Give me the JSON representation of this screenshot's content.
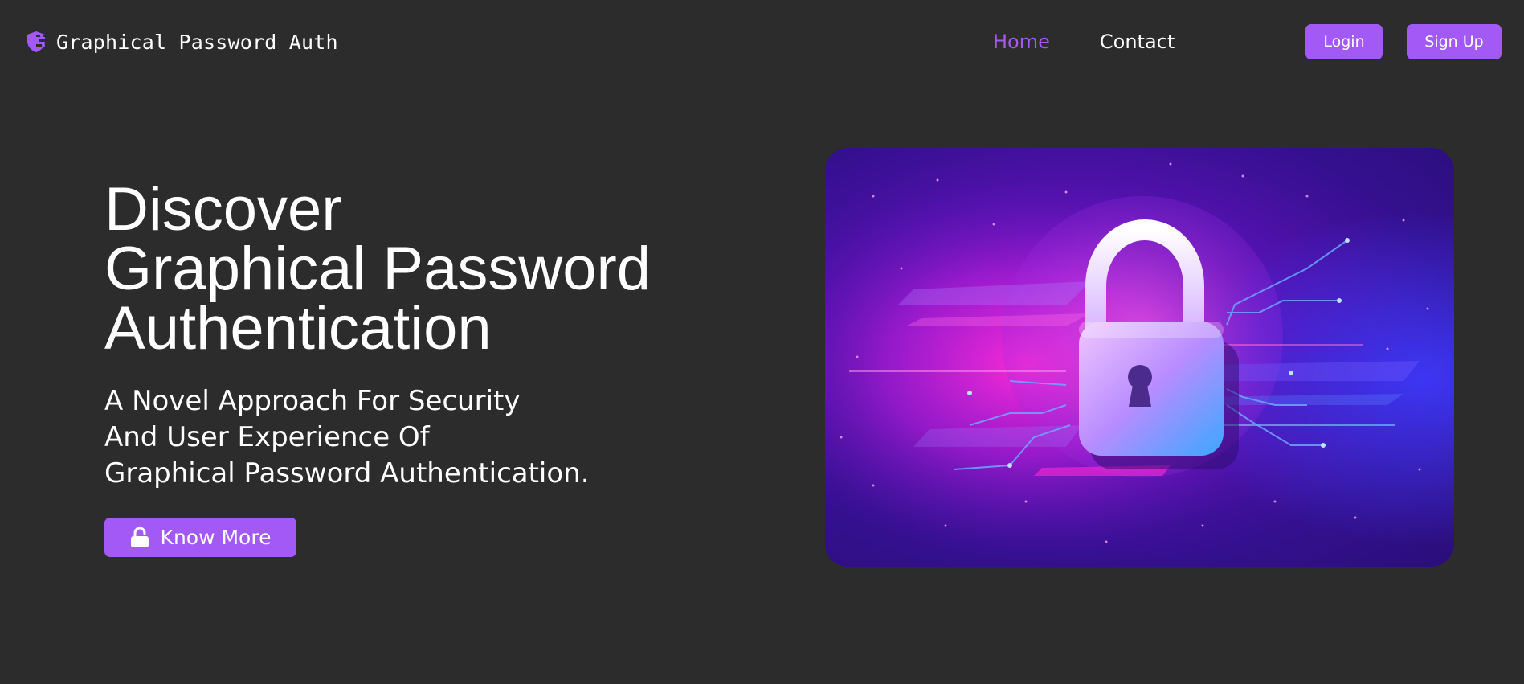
{
  "brand": {
    "name": "Graphical Password Auth",
    "icon": "shield-key-icon"
  },
  "nav": {
    "links": [
      {
        "label": "Home",
        "active": true
      },
      {
        "label": "Contact",
        "active": false
      }
    ],
    "login_label": "Login",
    "signup_label": "Sign Up"
  },
  "hero": {
    "title_lines": [
      "Discover",
      "Graphical Password",
      "Authentication"
    ],
    "subtitle_lines": [
      "A Novel Approach For Security",
      "And User Experience Of",
      "Graphical Password Authentication."
    ],
    "cta_label": "Know More",
    "cta_icon": "unlock-icon",
    "image_subject": "padlock-icon"
  },
  "colors": {
    "background": "#2c2c2c",
    "accent": "#a259f5",
    "text": "#ffffff"
  }
}
